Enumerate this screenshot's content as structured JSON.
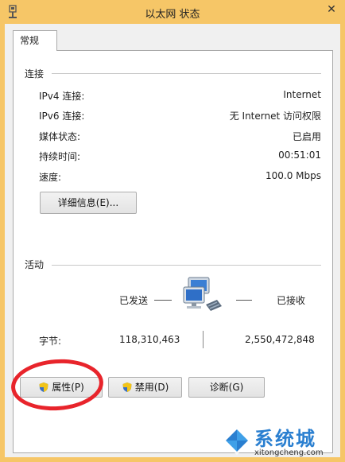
{
  "window": {
    "title": "以太网 状态",
    "close_glyph": "✕"
  },
  "tabs": [
    {
      "label": "常规"
    }
  ],
  "connection": {
    "section_label": "连接",
    "rows": [
      {
        "label": "IPv4 连接:",
        "value": "Internet"
      },
      {
        "label": "IPv6 连接:",
        "value": "无 Internet 访问权限"
      },
      {
        "label": "媒体状态:",
        "value": "已启用"
      },
      {
        "label": "持续时间:",
        "value": "00:51:01"
      },
      {
        "label": "速度:",
        "value": "100.0 Mbps"
      }
    ],
    "details_button": "详细信息(E)..."
  },
  "activity": {
    "section_label": "活动",
    "sent_label": "已发送",
    "received_label": "已接收",
    "bytes_label": "字节:",
    "bytes_sent": "118,310,463",
    "bytes_received": "2,550,472,848"
  },
  "buttons": {
    "properties": "属性(P)",
    "disable": "禁用(D)",
    "diagnose": "诊断(G)"
  },
  "watermark": {
    "text": "系统城",
    "url": "xitongcheng.com"
  },
  "colors": {
    "title_bar": "#f6c667",
    "annotation_circle": "#e8242b",
    "watermark": "#2a7fd0"
  }
}
